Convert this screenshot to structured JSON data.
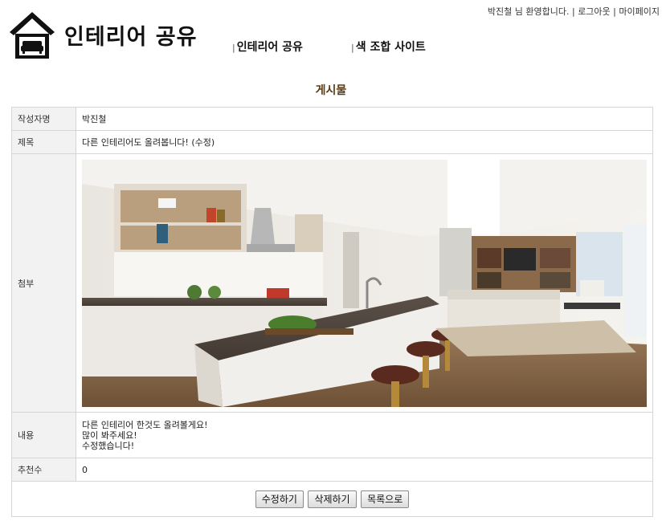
{
  "header": {
    "site_title": "인테리어 공유",
    "welcome_text": "박진철 님 환영합니다.",
    "separator": "|",
    "logout_label": "로그아웃",
    "mypage_label": "마이페이지"
  },
  "nav": {
    "items": [
      {
        "label": "인테리어 공유"
      },
      {
        "label": "색 조합 사이트"
      }
    ]
  },
  "page": {
    "heading": "게시물"
  },
  "post": {
    "author_label": "작성자명",
    "author_value": "박진철",
    "title_label": "제목",
    "title_value": "다른 인테리어도 올려봅니다! (수정)",
    "attach_label": "첨부",
    "content_label": "내용",
    "content_lines": [
      "다른 인테리어 한것도 올려볼게요!",
      "많이 봐주세요!",
      "수정했습니다!"
    ],
    "recommend_label": "추천수",
    "recommend_value": "0"
  },
  "buttons": {
    "edit_label": "수정하기",
    "delete_label": "삭제하기",
    "list_label": "목록으로"
  },
  "colors": {
    "heading": "#5a3b12",
    "header_cell_bg": "#f2f2f2",
    "border": "#d6d6d6"
  },
  "icons": {
    "logo": "house-sofa-icon"
  }
}
